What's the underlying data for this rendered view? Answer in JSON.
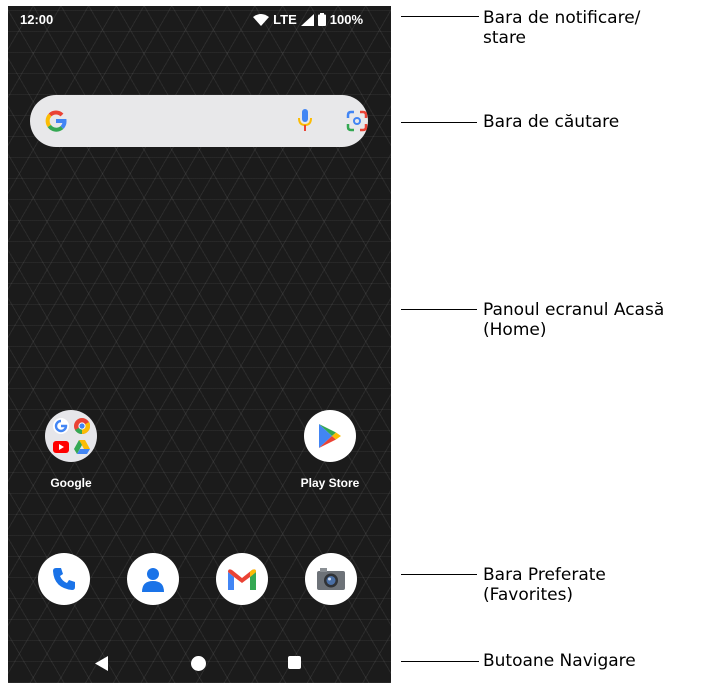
{
  "status_bar": {
    "time": "12:00",
    "network": "LTE",
    "battery": "100%",
    "icons": [
      "wifi-icon",
      "signal-icon",
      "battery-icon"
    ]
  },
  "search_bar": {
    "icons": [
      "google-g-icon",
      "microphone-icon",
      "google-lens-icon"
    ]
  },
  "home_apps": [
    {
      "label": "Google",
      "icon": "google-folder-icon"
    },
    {
      "label": "Play Store",
      "icon": "play-store-icon"
    }
  ],
  "favorites": [
    {
      "icon": "phone-icon"
    },
    {
      "icon": "contacts-icon"
    },
    {
      "icon": "gmail-icon"
    },
    {
      "icon": "camera-icon"
    }
  ],
  "nav_buttons": [
    "back-icon",
    "home-icon",
    "recents-icon"
  ],
  "callouts": {
    "status_bar": [
      "Bara de notificare/",
      "stare"
    ],
    "search_bar": [
      "Bara de căutare"
    ],
    "home_panel": [
      "Panoul ecranul Acasă",
      "(Home)"
    ],
    "favorites": [
      "Bara Preferate",
      "(Favorites)"
    ],
    "navigation": [
      "Butoane Navigare"
    ]
  },
  "colors": {
    "screen_bg": "#1b1b1b",
    "search_bg": "#e8e8ea",
    "google_blue": "#4285F4",
    "google_red": "#EA4335",
    "google_yellow": "#FBBC05",
    "google_green": "#34A853"
  }
}
